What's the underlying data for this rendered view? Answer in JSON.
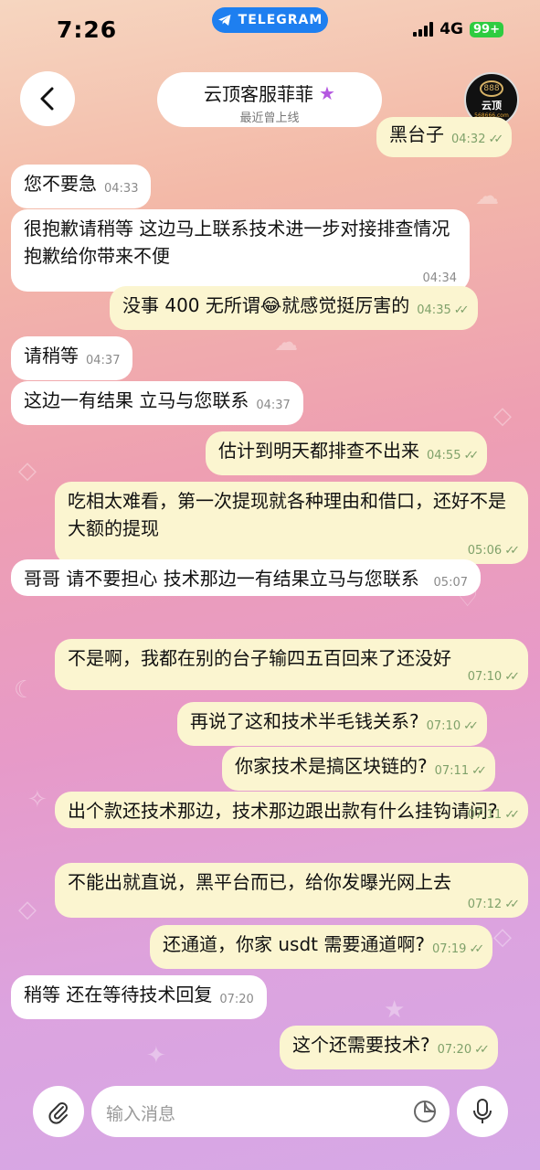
{
  "status_bar": {
    "time": "7:26",
    "pill_label": "TELEGRAM",
    "network": "4G",
    "battery": "99+"
  },
  "header": {
    "contact_name": "云顶客服菲菲",
    "last_seen": "最近曾上线",
    "avatar_text": "云顶",
    "avatar_ring": "888",
    "avatar_url": "568666.com"
  },
  "messages": [
    {
      "dir": "out",
      "text": "黑台子",
      "time": "04:32"
    },
    {
      "dir": "in",
      "text": "您不要急",
      "time": "04:33"
    },
    {
      "dir": "in",
      "text": "很抱歉请稍等 这边马上联系技术进一步对接排查情况抱歉给你带来不便",
      "time": "04:34"
    },
    {
      "dir": "out",
      "text": "没事 400 无所谓😂就感觉挺厉害的",
      "time": "04:35"
    },
    {
      "dir": "in",
      "text": "请稍等",
      "time": "04:37"
    },
    {
      "dir": "in",
      "text": "这边一有结果 立马与您联系",
      "time": "04:37"
    },
    {
      "dir": "out",
      "text": "估计到明天都排查不出来",
      "time": "04:55"
    },
    {
      "dir": "out",
      "text": "吃相太难看，第一次提现就各种理由和借口，还好不是大额的提现",
      "time": "05:06"
    },
    {
      "dir": "in",
      "text": "哥哥 请不要担心  技术那边一有结果立马与您联系",
      "time": "05:07"
    },
    {
      "dir": "out",
      "text": "不是啊，我都在别的台子输四五百回来了还没好",
      "time": "07:10"
    },
    {
      "dir": "out",
      "text": "再说了这和技术半毛钱关系?",
      "time": "07:10"
    },
    {
      "dir": "out",
      "text": "你家技术是搞区块链的?",
      "time": "07:11"
    },
    {
      "dir": "out",
      "text": "出个款还技术那边，技术那边跟出款有什么挂钩请问?",
      "time": "07:11"
    },
    {
      "dir": "out",
      "text": "不能出就直说，黑平台而已，给你发曝光网上去",
      "time": "07:12"
    },
    {
      "dir": "out",
      "text": "还通道，你家 usdt 需要通道啊?",
      "time": "07:19"
    },
    {
      "dir": "in",
      "text": "稍等   还在等待技术回复",
      "time": "07:20"
    },
    {
      "dir": "out",
      "text": "这个还需要技术?",
      "time": "07:20"
    }
  ],
  "composer": {
    "placeholder": "输入消息"
  },
  "icons": [
    "back-arrow-icon",
    "star-icon",
    "paperclip-icon",
    "sticker-icon",
    "microphone-icon",
    "telegram-plane-icon"
  ],
  "colors": {
    "incoming_bubble": "#ffffff",
    "outgoing_bubble": "#fbf5d0",
    "read_ticks": "#7fa16a",
    "telegram_blue": "#1e7ff0",
    "premium_star": "#b457e0"
  }
}
